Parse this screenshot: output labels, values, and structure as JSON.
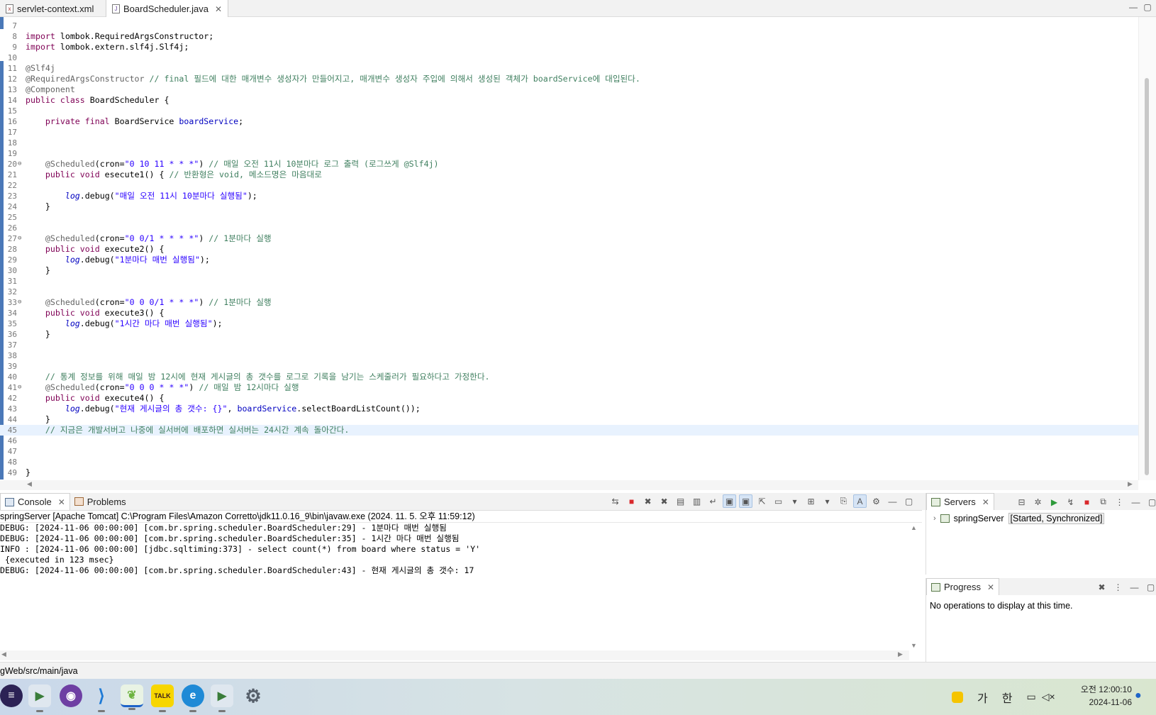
{
  "tabs": [
    {
      "label": "servlet-context.xml",
      "icon": "xml-file-icon"
    },
    {
      "label": "BoardScheduler.java",
      "icon": "java-file-icon"
    }
  ],
  "editor": {
    "lines": [
      {
        "n": "7",
        "segs": []
      },
      {
        "n": "8",
        "segs": [
          {
            "t": "import",
            "c": "k"
          },
          {
            "t": " lombok.RequiredArgsConstructor;",
            "c": ""
          }
        ]
      },
      {
        "n": "9",
        "segs": [
          {
            "t": "import",
            "c": "k"
          },
          {
            "t": " lombok.extern.slf4j.Slf4j;",
            "c": ""
          }
        ]
      },
      {
        "n": "10",
        "segs": []
      },
      {
        "n": "11",
        "segs": [
          {
            "t": "@Slf4j",
            "c": "ann"
          }
        ]
      },
      {
        "n": "12",
        "segs": [
          {
            "t": "@RequiredArgsConstructor",
            "c": "ann"
          },
          {
            "t": " // final 필드에 대한 매개변수 생성자가 만들어지고, 매개변수 생성자 주입에 의해서 생성된 객체가 boardService에 대입된다.",
            "c": "cm"
          }
        ]
      },
      {
        "n": "13",
        "segs": [
          {
            "t": "@Component",
            "c": "ann"
          }
        ]
      },
      {
        "n": "14",
        "segs": [
          {
            "t": "public class",
            "c": "k"
          },
          {
            "t": " BoardScheduler {",
            "c": ""
          }
        ]
      },
      {
        "n": "15",
        "segs": []
      },
      {
        "n": "16",
        "segs": [
          {
            "t": "    ",
            "c": ""
          },
          {
            "t": "private final",
            "c": "k"
          },
          {
            "t": " BoardService ",
            "c": ""
          },
          {
            "t": "boardService",
            "c": "fd"
          },
          {
            "t": ";",
            "c": ""
          }
        ]
      },
      {
        "n": "17",
        "segs": []
      },
      {
        "n": "18",
        "segs": []
      },
      {
        "n": "19",
        "segs": []
      },
      {
        "n": "20",
        "fold": true,
        "segs": [
          {
            "t": "    ",
            "c": ""
          },
          {
            "t": "@Scheduled",
            "c": "ann"
          },
          {
            "t": "(cron=",
            "c": ""
          },
          {
            "t": "\"0 10 11 * * *\"",
            "c": "st"
          },
          {
            "t": ") ",
            "c": ""
          },
          {
            "t": "// 매일 오전 11시 10분마다 로그 출력 (로그쓰게 @Slf4j)",
            "c": "cm"
          }
        ]
      },
      {
        "n": "21",
        "segs": [
          {
            "t": "    ",
            "c": ""
          },
          {
            "t": "public void",
            "c": "k"
          },
          {
            "t": " esecute1() { ",
            "c": ""
          },
          {
            "t": "// 반환형은 void, 메소드명은 마음대로",
            "c": "cm"
          }
        ]
      },
      {
        "n": "22",
        "segs": []
      },
      {
        "n": "23",
        "segs": [
          {
            "t": "        ",
            "c": ""
          },
          {
            "t": "log",
            "c": "it"
          },
          {
            "t": ".debug(",
            "c": ""
          },
          {
            "t": "\"매일 오전 11시 10분마다 실행됨\"",
            "c": "st"
          },
          {
            "t": ");",
            "c": ""
          }
        ]
      },
      {
        "n": "24",
        "segs": [
          {
            "t": "    }",
            "c": ""
          }
        ]
      },
      {
        "n": "25",
        "segs": []
      },
      {
        "n": "26",
        "segs": []
      },
      {
        "n": "27",
        "fold": true,
        "segs": [
          {
            "t": "    ",
            "c": ""
          },
          {
            "t": "@Scheduled",
            "c": "ann"
          },
          {
            "t": "(cron=",
            "c": ""
          },
          {
            "t": "\"0 0/1 * * * *\"",
            "c": "st"
          },
          {
            "t": ") ",
            "c": ""
          },
          {
            "t": "// 1분마다 실행",
            "c": "cm"
          }
        ]
      },
      {
        "n": "28",
        "segs": [
          {
            "t": "    ",
            "c": ""
          },
          {
            "t": "public void",
            "c": "k"
          },
          {
            "t": " execute2() {",
            "c": ""
          }
        ]
      },
      {
        "n": "29",
        "segs": [
          {
            "t": "        ",
            "c": ""
          },
          {
            "t": "log",
            "c": "it"
          },
          {
            "t": ".debug(",
            "c": ""
          },
          {
            "t": "\"1분마다 매번 실행됨\"",
            "c": "st"
          },
          {
            "t": ");",
            "c": ""
          }
        ]
      },
      {
        "n": "30",
        "segs": [
          {
            "t": "    }",
            "c": ""
          }
        ]
      },
      {
        "n": "31",
        "segs": []
      },
      {
        "n": "32",
        "segs": []
      },
      {
        "n": "33",
        "fold": true,
        "segs": [
          {
            "t": "    ",
            "c": ""
          },
          {
            "t": "@Scheduled",
            "c": "ann"
          },
          {
            "t": "(cron=",
            "c": ""
          },
          {
            "t": "\"0 0 0/1 * * *\"",
            "c": "st"
          },
          {
            "t": ") ",
            "c": ""
          },
          {
            "t": "// 1분마다 실행",
            "c": "cm"
          }
        ]
      },
      {
        "n": "34",
        "segs": [
          {
            "t": "    ",
            "c": ""
          },
          {
            "t": "public void",
            "c": "k"
          },
          {
            "t": " execute3() {",
            "c": ""
          }
        ]
      },
      {
        "n": "35",
        "segs": [
          {
            "t": "        ",
            "c": ""
          },
          {
            "t": "log",
            "c": "it"
          },
          {
            "t": ".debug(",
            "c": ""
          },
          {
            "t": "\"1시간 마다 매번 실행됨\"",
            "c": "st"
          },
          {
            "t": ");",
            "c": ""
          }
        ]
      },
      {
        "n": "36",
        "segs": [
          {
            "t": "    }",
            "c": ""
          }
        ]
      },
      {
        "n": "37",
        "segs": []
      },
      {
        "n": "38",
        "segs": []
      },
      {
        "n": "39",
        "segs": []
      },
      {
        "n": "40",
        "segs": [
          {
            "t": "    ",
            "c": ""
          },
          {
            "t": "// 통계 정보를 위해 매일 밤 12시에 현재 게시글의 총 갯수를 로그로 기록을 남기는 스케줄러가 필요하다고 가정한다.",
            "c": "cm"
          }
        ]
      },
      {
        "n": "41",
        "fold": true,
        "segs": [
          {
            "t": "    ",
            "c": ""
          },
          {
            "t": "@Scheduled",
            "c": "ann"
          },
          {
            "t": "(cron=",
            "c": ""
          },
          {
            "t": "\"0 0 0 * * *\"",
            "c": "st"
          },
          {
            "t": ") ",
            "c": ""
          },
          {
            "t": "// 매일 밤 12시마다 실행",
            "c": "cm"
          }
        ]
      },
      {
        "n": "42",
        "segs": [
          {
            "t": "    ",
            "c": ""
          },
          {
            "t": "public void",
            "c": "k"
          },
          {
            "t": " execute4() {",
            "c": ""
          }
        ]
      },
      {
        "n": "43",
        "segs": [
          {
            "t": "        ",
            "c": ""
          },
          {
            "t": "log",
            "c": "it"
          },
          {
            "t": ".debug(",
            "c": ""
          },
          {
            "t": "\"현재 게시글의 총 갯수: {}\"",
            "c": "st"
          },
          {
            "t": ", ",
            "c": ""
          },
          {
            "t": "boardService",
            "c": "fd"
          },
          {
            "t": ".selectBoardListCount());",
            "c": ""
          }
        ]
      },
      {
        "n": "44",
        "segs": [
          {
            "t": "    }",
            "c": ""
          }
        ]
      },
      {
        "n": "45",
        "cur": true,
        "segs": [
          {
            "t": "    ",
            "c": ""
          },
          {
            "t": "// 지금은 개발서버고 나중에 실서버에 배포하면 실서버는 24시간 계속 돌아간다.",
            "c": "cm"
          }
        ]
      },
      {
        "n": "46",
        "segs": []
      },
      {
        "n": "47",
        "segs": []
      },
      {
        "n": "48",
        "segs": []
      },
      {
        "n": "49",
        "segs": [
          {
            "t": "}",
            "c": ""
          }
        ]
      }
    ]
  },
  "console": {
    "tab_label": "Console",
    "problems_label": "Problems",
    "header": "springServer [Apache Tomcat] C:\\Program Files\\Amazon Corretto\\jdk11.0.16_9\\bin\\javaw.exe  (2024. 11. 5. 오후 11:59:12)",
    "lines": [
      "DEBUG: [2024-11-06 00:00:00] [com.br.spring.scheduler.BoardScheduler:29] - 1분마다 매번 실행됨",
      "DEBUG: [2024-11-06 00:00:00] [com.br.spring.scheduler.BoardScheduler:35] - 1시간 마다 매번 실행됨",
      "INFO : [2024-11-06 00:00:00] [jdbc.sqltiming:373] - select count(*) from board where status = 'Y'",
      " {executed in 123 msec}",
      "DEBUG: [2024-11-06 00:00:00] [com.br.spring.scheduler.BoardScheduler:43] - 현재 게시글의 총 갯수: 17"
    ]
  },
  "servers": {
    "tab_label": "Servers",
    "item_name": "springServer",
    "item_status": "[Started, Synchronized]"
  },
  "progress": {
    "tab_label": "Progress",
    "message": "No operations to display at this time."
  },
  "statusbar": {
    "path": "gWeb/src/main/java"
  },
  "taskbar": {
    "ime_mode": "가",
    "ime_lang": "한",
    "time": "오전 12:00:10",
    "date": "2024-11-06"
  },
  "colors": {
    "keyword": "#7f0055",
    "comment": "#3f7f5f",
    "string": "#2a00ff",
    "field": "#0000c0",
    "annotation": "#646464",
    "current_line": "#e8f2fe"
  }
}
